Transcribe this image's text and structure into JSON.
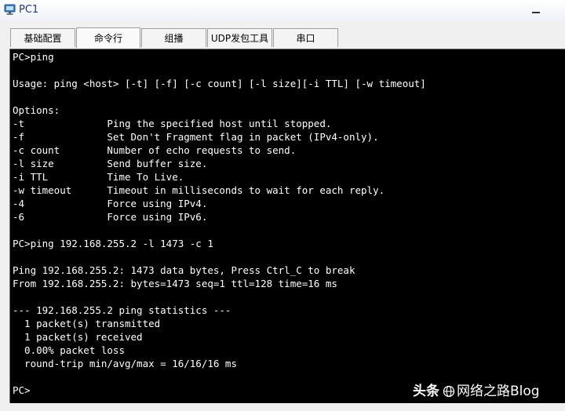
{
  "window": {
    "title": "PC1"
  },
  "tabs": [
    {
      "label": "基础配置"
    },
    {
      "label": "命令行"
    },
    {
      "label": "组播"
    },
    {
      "label": "UDP发包工具"
    },
    {
      "label": "串口"
    }
  ],
  "active_tab": "命令行",
  "terminal": {
    "lines": [
      "PC>ping",
      "",
      "Usage: ping <host> [-t] [-f] [-c count] [-l size][-i TTL] [-w timeout]",
      "",
      "Options:",
      "-t              Ping the specified host until stopped.",
      "-f              Set Don't Fragment flag in packet (IPv4-only).",
      "-c count        Number of echo requests to send.",
      "-l size         Send buffer size.",
      "-i TTL          Time To Live.",
      "-w timeout      Timeout in milliseconds to wait for each reply.",
      "-4              Force using IPv4.",
      "-6              Force using IPv6.",
      "",
      "PC>ping 192.168.255.2 -l 1473 -c 1",
      "",
      "Ping 192.168.255.2: 1473 data bytes, Press Ctrl_C to break",
      "From 192.168.255.2: bytes=1473 seq=1 ttl=128 time=16 ms",
      "",
      "--- 192.168.255.2 ping statistics ---",
      "  1 packet(s) transmitted",
      "  1 packet(s) received",
      "  0.00% packet loss",
      "  round-trip min/avg/max = 16/16/16 ms",
      "",
      "PC>"
    ]
  },
  "watermark": {
    "brand": "头条",
    "account": "网络之路Blog"
  },
  "colors": {
    "terminal_bg": "#000000",
    "terminal_fg": "#ffffff",
    "title_text": "#1e3c78"
  },
  "icons": {
    "app": "pc-monitor-icon",
    "minimize": "minimize-icon",
    "watermark": "globe-icon"
  }
}
